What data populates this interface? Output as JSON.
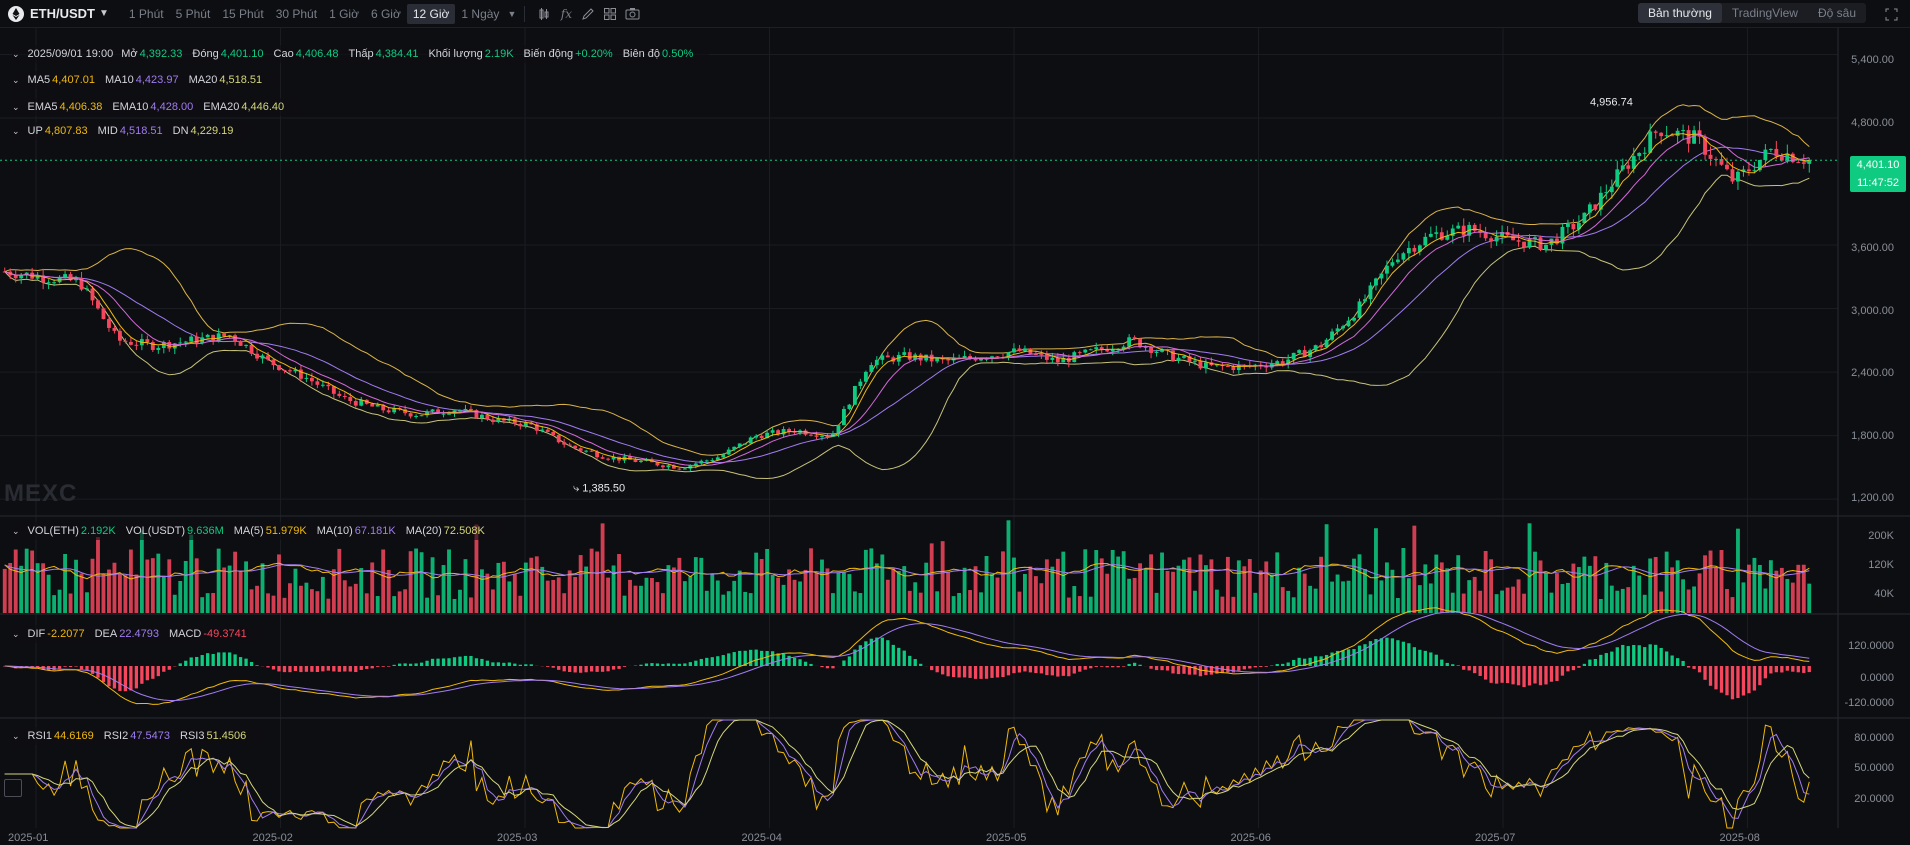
{
  "toolbar": {
    "symbol": "ETH/USDT",
    "timeframes": [
      "1 Phút",
      "5 Phút",
      "15 Phút",
      "30 Phút",
      "1 Giờ",
      "6 Giờ",
      "12 Giờ",
      "1 Ngày"
    ],
    "active_timeframe": "12 Giờ",
    "view_modes": [
      "Bản thường",
      "TradingView",
      "Độ sâu"
    ],
    "active_view": "Bản thường"
  },
  "ohlc": {
    "date": "2025/09/01 19:00",
    "open_label": "Mở",
    "open": "4,392.33",
    "close_label": "Đóng",
    "close": "4,401.10",
    "high_label": "Cao",
    "high": "4,406.48",
    "low_label": "Thấp",
    "low": "4,384.41",
    "volume_label": "Khối lượng",
    "volume": "2.19K",
    "change_label": "Biến động",
    "change": "+0.20%",
    "amplitude_label": "Biên độ",
    "amplitude": "0.50%"
  },
  "ma_legend": [
    {
      "label": "MA5",
      "value": "4,407.01",
      "color": "#f0b90b"
    },
    {
      "label": "MA10",
      "value": "4,423.97",
      "color": "#a07cf0"
    },
    {
      "label": "MA20",
      "value": "4,518.51",
      "color": "#d4d67a"
    }
  ],
  "ema_legend": [
    {
      "label": "EMA5",
      "value": "4,406.38",
      "color": "#f0b90b"
    },
    {
      "label": "EMA10",
      "value": "4,428.00",
      "color": "#a07cf0"
    },
    {
      "label": "EMA20",
      "value": "4,446.40",
      "color": "#d4d67a"
    }
  ],
  "boll_legend": [
    {
      "label": "UP",
      "value": "4,807.83",
      "color": "#f0b90b"
    },
    {
      "label": "MID",
      "value": "4,518.51",
      "color": "#a07cf0"
    },
    {
      "label": "DN",
      "value": "4,229.19",
      "color": "#d4d67a"
    }
  ],
  "vol_legend": [
    {
      "label": "VOL(ETH)",
      "value": "2.192K",
      "color": "#0ecb81"
    },
    {
      "label": "VOL(USDT)",
      "value": "9.636M",
      "color": "#0ecb81"
    },
    {
      "label": "MA(5)",
      "value": "51.979K",
      "color": "#f0b90b"
    },
    {
      "label": "MA(10)",
      "value": "67.181K",
      "color": "#a07cf0"
    },
    {
      "label": "MA(20)",
      "value": "72.508K",
      "color": "#d4d67a"
    }
  ],
  "macd_legend": [
    {
      "label": "DIF",
      "value": "-2.2077",
      "color": "#f0b90b"
    },
    {
      "label": "DEA",
      "value": "22.4793",
      "color": "#a07cf0"
    },
    {
      "label": "MACD",
      "value": "-49.3741",
      "color": "#f6465d"
    }
  ],
  "rsi_legend": [
    {
      "label": "RSI1",
      "value": "44.6169",
      "color": "#f0b90b"
    },
    {
      "label": "RSI2",
      "value": "47.5473",
      "color": "#a07cf0"
    },
    {
      "label": "RSI3",
      "value": "51.4506",
      "color": "#d4d67a"
    }
  ],
  "price_axis": [
    "5,400.00",
    "4,800.00",
    "3,600.00",
    "3,000.00",
    "2,400.00",
    "1,800.00",
    "1,200.00"
  ],
  "vol_axis": [
    "200K",
    "120K",
    "40K"
  ],
  "macd_axis": [
    "120.0000",
    "0.0000",
    "-120.0000"
  ],
  "rsi_axis": [
    "80.0000",
    "50.0000",
    "20.0000"
  ],
  "time_axis": [
    "2025-01",
    "2025-02",
    "2025-03",
    "2025-04",
    "2025-05",
    "2025-06",
    "2025-07",
    "2025-08"
  ],
  "current_price": "4,401.10",
  "countdown": "11:47:52",
  "watermark": "MEXC",
  "annotations": {
    "high": "4,956.74",
    "low": "1,385.50"
  },
  "colors": {
    "up": "#0ecb81",
    "down": "#f6465d",
    "background": "#0d0e12"
  },
  "chart_data": {
    "type": "candlestick",
    "interval": "12h",
    "ylim": [
      1050,
      5650
    ],
    "series": [
      {
        "name": "close",
        "x": [
          "2025-01-01",
          "2025-01-05",
          "2025-01-10",
          "2025-01-15",
          "2025-01-20",
          "2025-01-25",
          "2025-02-01",
          "2025-02-05",
          "2025-02-10",
          "2025-02-15",
          "2025-02-20",
          "2025-02-25",
          "2025-03-01",
          "2025-03-05",
          "2025-03-10",
          "2025-03-15",
          "2025-03-20",
          "2025-03-25",
          "2025-04-01",
          "2025-04-05",
          "2025-04-10",
          "2025-04-15",
          "2025-04-20",
          "2025-04-25",
          "2025-05-01",
          "2025-05-05",
          "2025-05-10",
          "2025-05-15",
          "2025-05-20",
          "2025-05-25",
          "2025-06-01",
          "2025-06-05",
          "2025-06-10",
          "2025-06-15",
          "2025-06-20",
          "2025-06-25",
          "2025-07-01",
          "2025-07-05",
          "2025-07-10",
          "2025-07-15",
          "2025-07-20",
          "2025-07-25",
          "2025-08-01",
          "2025-08-05",
          "2025-08-10",
          "2025-08-15",
          "2025-08-20",
          "2025-08-25",
          "2025-09-01"
        ],
        "values": [
          3350,
          3300,
          3250,
          2700,
          2650,
          2700,
          2750,
          2500,
          2350,
          2150,
          2050,
          2000,
          2050,
          1950,
          1900,
          1700,
          1600,
          1550,
          1500,
          1600,
          1800,
          1850,
          1800,
          2500,
          2550,
          2500,
          2550,
          2600,
          2500,
          2600,
          2700,
          2550,
          2450,
          2450,
          2500,
          2650,
          3000,
          3500,
          3700,
          3750,
          3650,
          3600,
          3850,
          4300,
          4700,
          4600,
          4200,
          4500,
          4401
        ]
      }
    ],
    "bollinger": {
      "up": "4,807.83",
      "mid": "4,518.51",
      "dn": "4,229.19"
    },
    "high_marker": {
      "x": "2025-08",
      "y": 4956.74
    },
    "low_marker": {
      "x": "2025-03",
      "y": 1385.5
    },
    "volume": {
      "ylim": [
        0,
        240000
      ]
    },
    "macd": {
      "ylim": [
        -180,
        180
      ]
    },
    "rsi": {
      "ylim": [
        0,
        100
      ]
    }
  }
}
